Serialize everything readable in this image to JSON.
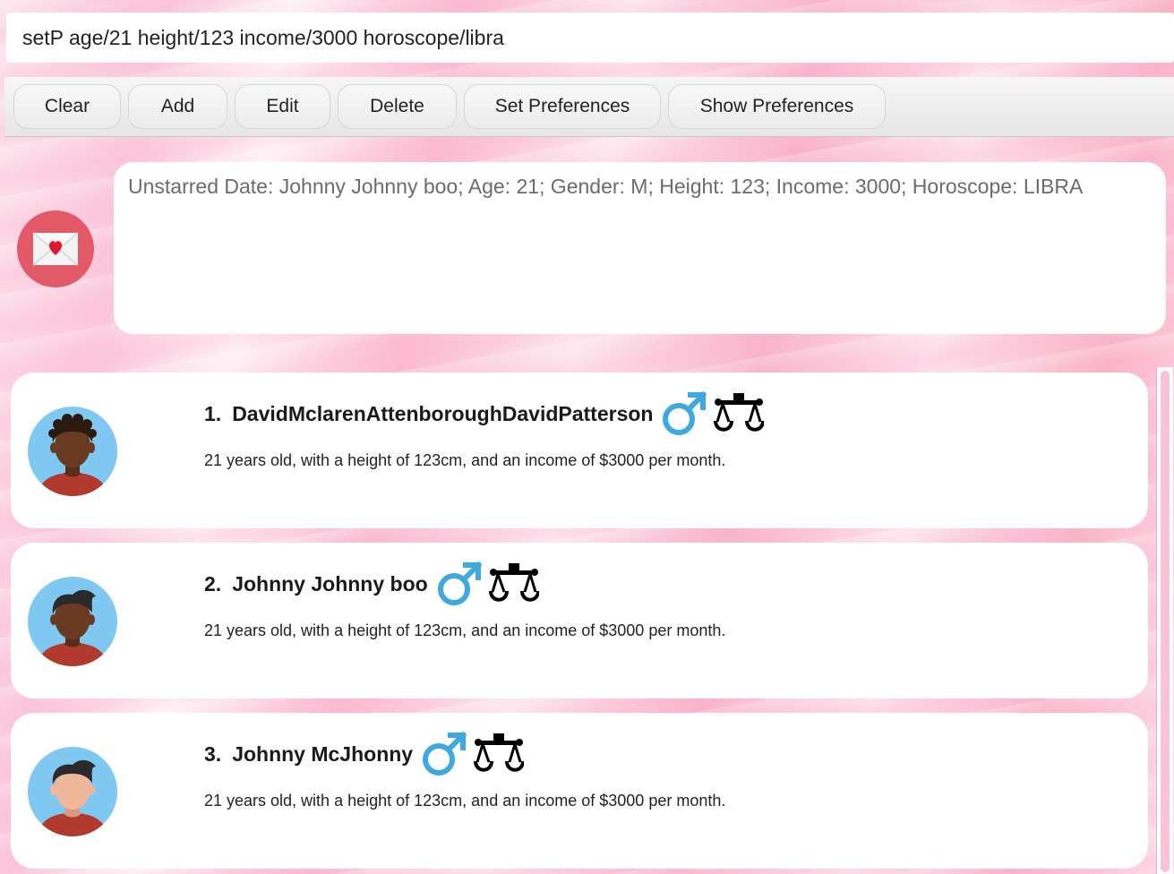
{
  "command": {
    "value": "setP age/21 height/123 income/3000 horoscope/libra"
  },
  "toolbar": {
    "clear": "Clear",
    "add": "Add",
    "edit": "Edit",
    "delete": "Delete",
    "set_preferences": "Set Preferences",
    "show_preferences": "Show Preferences"
  },
  "result": {
    "icon": "mail-heart-icon",
    "text": "Unstarred Date: Johnny Johnny boo; Age: 21; Gender: M; Height: 123; Income: 3000; Horoscope: LIBRA"
  },
  "dates": [
    {
      "index": "1.",
      "name": "DavidMclarenAttenboroughDavidPatterson",
      "gender_icon": "male-icon",
      "horoscope_icon": "libra-icon",
      "description": "21 years old, with a height of 123cm, and an income of $3000 per month.",
      "avatar_skin": "#6b3a22",
      "avatar_hair": "#2a1a10"
    },
    {
      "index": "2.",
      "name": "Johnny Johnny boo",
      "gender_icon": "male-icon",
      "horoscope_icon": "libra-icon",
      "description": "21 years old, with a height of 123cm, and an income of $3000 per month.",
      "avatar_skin": "#6b3a22",
      "avatar_hair": "#2b2b2b"
    },
    {
      "index": "3.",
      "name": "Johnny McJhonny",
      "gender_icon": "male-icon",
      "horoscope_icon": "libra-icon",
      "description": "21 years old, with a height of 123cm, and an income of $3000 per month.",
      "avatar_skin": "#f0b79a",
      "avatar_hair": "#2b2b2b"
    }
  ],
  "colors": {
    "accent": "#e25a67",
    "male_blue": "#3fa8dc",
    "avatar_bg": "#7ec8f2",
    "shirt": "#b23a2c"
  }
}
